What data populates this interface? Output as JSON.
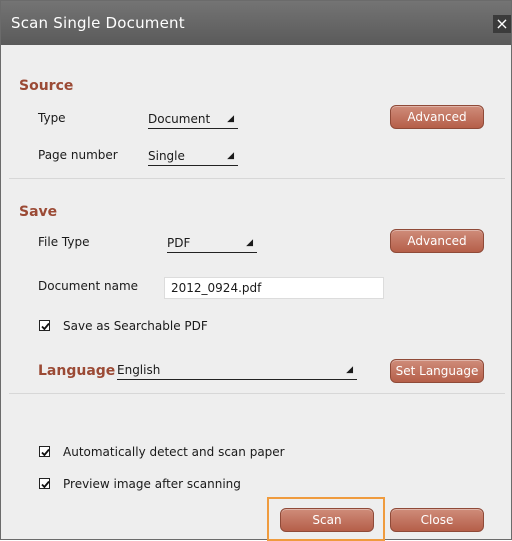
{
  "window": {
    "title": "Scan Single Document",
    "close_glyph": "×"
  },
  "source": {
    "heading": "Source",
    "type_label": "Type",
    "type_value": "Document",
    "page_label": "Page number",
    "page_value": "Single",
    "advanced_label": "Advanced"
  },
  "save": {
    "heading": "Save",
    "file_type_label": "File Type",
    "file_type_value": "PDF",
    "doc_name_label": "Document name",
    "doc_name_value": "2012_0924.pdf",
    "searchable_label": "Save as Searchable PDF",
    "advanced_label": "Advanced"
  },
  "language": {
    "label": "Language",
    "value": "English",
    "set_button": "Set Language"
  },
  "options": {
    "auto_detect": "Automatically detect and scan  paper",
    "preview": "Preview image after scanning"
  },
  "footer": {
    "scan": "Scan",
    "close": "Close"
  },
  "colors": {
    "accent": "#9b4a35",
    "button": "#c07360",
    "highlight": "#ef9b3e"
  },
  "icons": {
    "dropdown": "triangle-down-icon",
    "checkbox": "checkmark-icon",
    "close": "close-icon"
  }
}
